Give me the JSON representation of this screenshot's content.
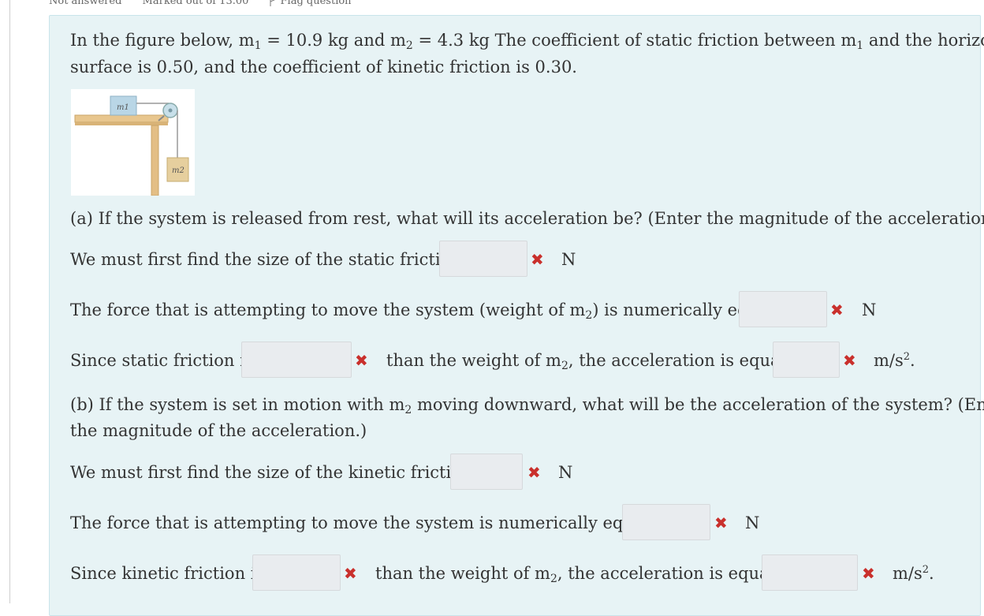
{
  "header": {
    "status": "Not answered",
    "marks": "Marked out of 13.00",
    "flag": "Flag question"
  },
  "question": {
    "intro_line1_pre": "In the figure below, m",
    "intro_line1_mid": " = 10.9 kg and m",
    "intro_line1_post": " = 4.3 kg The coefficient of static friction between m",
    "intro_line1_end": " and the horizontal",
    "intro_line2": "surface is 0.50, and the coefficient of kinetic friction is 0.30.",
    "sub1": "1",
    "sub2": "2",
    "figure": {
      "label_m1": "m1",
      "label_m2": "m2"
    },
    "part_a": {
      "prompt": "(a) If the system is released from rest, what will its acceleration be? (Enter the magnitude of the acceleration.)",
      "static_friction_label": "We must first find the size of the static friction:",
      "force_label_pre": "The force that is attempting to move the system (weight of m",
      "force_label_post": ") is numerically equal to",
      "since_label": "Since static friction is",
      "than_label_pre": "than the weight of m",
      "than_label_post": ", the acceleration is equal to"
    },
    "part_b": {
      "prompt_line1_pre": "(b) If the system is set in motion with m",
      "prompt_line1_post": " moving downward, what will be the acceleration of the system? (Enter",
      "prompt_line2": "the magnitude of the acceleration.)",
      "kinetic_friction_label": "We must first find the size of the kinetic friction:",
      "force_label": "The force that is attempting to move the system is numerically equal to",
      "since_label": "Since kinetic friction is",
      "than_label_pre": "than the weight of m",
      "than_label_post": ", the acceleration is equal to"
    },
    "units": {
      "newton": "N",
      "accel": "m/s",
      "accel_exp": "2",
      "period": "."
    },
    "incorrect_mark": "✖"
  },
  "colors": {
    "incorrect": "#c9302c",
    "panel": "#e7f3f5",
    "input": "#e9ecef"
  }
}
